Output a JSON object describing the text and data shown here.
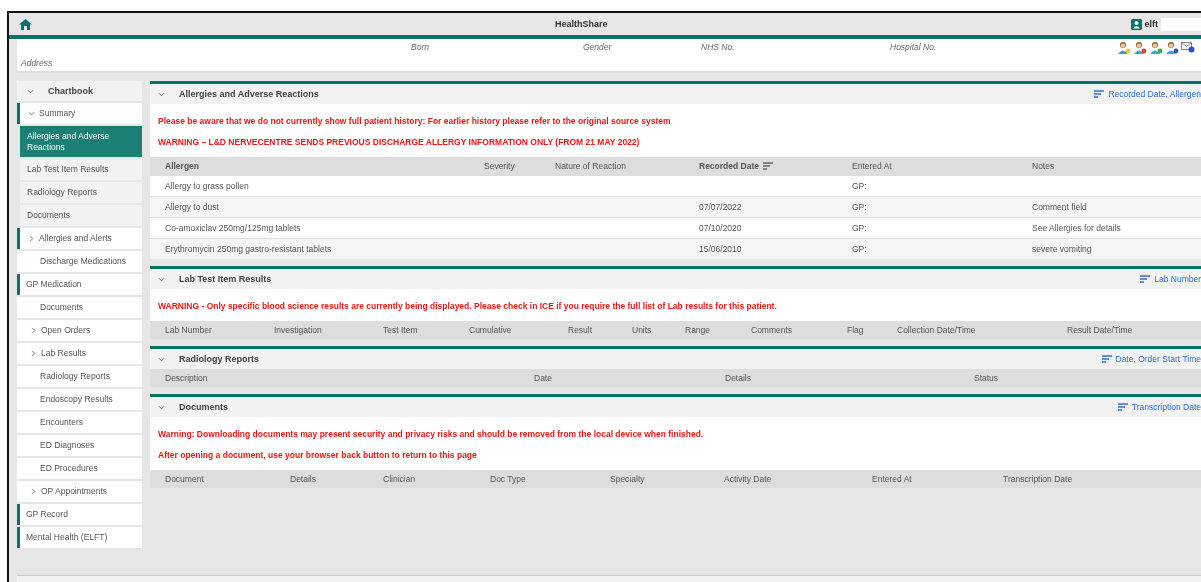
{
  "app_bar": {
    "title": "HealthShare",
    "user": "elft"
  },
  "patient_banner": {
    "fields": [
      "Born",
      "Gender",
      "NHS No.",
      "Hospital No."
    ],
    "address_label": "Address"
  },
  "sidebar": {
    "title": "Chartbook",
    "expanded": true,
    "items": [
      {
        "label": "Summary",
        "kind": "section",
        "expanded": true,
        "selected": false
      },
      {
        "label": "Allergies and Adverse Reactions",
        "kind": "child",
        "selected": true
      },
      {
        "label": "Lab Test Item Results",
        "kind": "child",
        "selected": false
      },
      {
        "label": "Radiology Reports",
        "kind": "child",
        "selected": false
      },
      {
        "label": "Documents",
        "kind": "child",
        "selected": false
      },
      {
        "label": "Allergies and Alerts",
        "kind": "section",
        "expanded": false,
        "selected": false
      },
      {
        "label": "Discharge Medications",
        "kind": "sub",
        "selected": false
      },
      {
        "label": "GP Medication",
        "kind": "section",
        "selected": false
      },
      {
        "label": "Documents",
        "kind": "sub",
        "selected": false
      },
      {
        "label": "Open Orders",
        "kind": "sub",
        "expanded": false,
        "selected": false
      },
      {
        "label": "Lab Results",
        "kind": "sub",
        "expanded": false,
        "selected": false
      },
      {
        "label": "Radiology Reports",
        "kind": "sub",
        "selected": false
      },
      {
        "label": "Endoscopy Results",
        "kind": "sub",
        "selected": false
      },
      {
        "label": "Encounters",
        "kind": "sub",
        "selected": false
      },
      {
        "label": "ED Diagnoses",
        "kind": "sub",
        "selected": false
      },
      {
        "label": "ED Procedures",
        "kind": "sub",
        "selected": false
      },
      {
        "label": "OP Appointments",
        "kind": "sub",
        "expanded": false,
        "selected": false
      },
      {
        "label": "GP Record",
        "kind": "section",
        "selected": false
      },
      {
        "label": "Mental Health (ELFT)",
        "kind": "section",
        "selected": false
      }
    ]
  },
  "sections": [
    {
      "kind": "allergies",
      "title": "Allergies and Adverse Reactions",
      "expanded": true,
      "sort": "Recorded Date, Allergen",
      "warnings": [
        "Please be aware that we do not currently show full patient history: For earlier history please refer to the original source system",
        "WARNING – L&D NERVECENTRE SENDS PREVIOUS DISCHARGE ALLERGY INFORMATION ONLY (FROM 21 MAY 2022)"
      ],
      "columns": [
        {
          "label": "Allergen",
          "bold": true,
          "sorted": false
        },
        {
          "label": "Severity",
          "bold": false,
          "sorted": false
        },
        {
          "label": "Nature of Reaction",
          "bold": false,
          "sorted": false
        },
        {
          "label": "Recorded Date",
          "bold": true,
          "sorted": true
        },
        {
          "label": "Entered At",
          "bold": false,
          "sorted": false
        },
        {
          "label": "Notes",
          "bold": false,
          "sorted": false
        }
      ],
      "rows": [
        [
          "Allergy to grass pollen",
          "",
          "",
          "",
          "GP:",
          ""
        ],
        [
          "Allergy to dust",
          "",
          "",
          "07/07/2022",
          "GP:",
          "Comment field"
        ],
        [
          "Co-amoxiclav 250mg/125mg tablets",
          "",
          "",
          "07/10/2020",
          "GP:",
          "See Allergies for details"
        ],
        [
          "Erythromycin 250mg gastro-resistant tablets",
          "",
          "",
          "15/06/2010",
          "GP:",
          "severe vomiting"
        ]
      ]
    },
    {
      "kind": "lab",
      "title": "Lab Test Item Results",
      "expanded": true,
      "sort": "Lab Number",
      "warnings": [
        "WARNING - Only specific blood science results are currently being displayed. Please check in ICE if you require the full list of Lab results for this patient."
      ],
      "columns": [
        {
          "label": "Lab Number",
          "bold": false,
          "sorted": false
        },
        {
          "label": "Investigation",
          "bold": false,
          "sorted": false
        },
        {
          "label": "Test Item",
          "bold": false,
          "sorted": false
        },
        {
          "label": "Cumulative",
          "bold": false,
          "sorted": false
        },
        {
          "label": "Result",
          "bold": false,
          "sorted": false
        },
        {
          "label": "Units",
          "bold": false,
          "sorted": false
        },
        {
          "label": "Range",
          "bold": false,
          "sorted": false
        },
        {
          "label": "Comments",
          "bold": false,
          "sorted": false
        },
        {
          "label": "Flag",
          "bold": false,
          "sorted": false
        },
        {
          "label": "Collection Date/Time",
          "bold": false,
          "sorted": false
        },
        {
          "label": "Result Date/Time",
          "bold": false,
          "sorted": false
        }
      ]
    },
    {
      "kind": "radiology",
      "title": "Radiology Reports",
      "expanded": true,
      "sort": "Date, Order Start Time",
      "columns": [
        {
          "label": "Description",
          "bold": false,
          "sorted": false
        },
        {
          "label": "Date",
          "bold": false,
          "sorted": false
        },
        {
          "label": "Details",
          "bold": false,
          "sorted": false
        },
        {
          "label": "Status",
          "bold": false,
          "sorted": false
        }
      ]
    },
    {
      "kind": "documents",
      "title": "Documents",
      "expanded": true,
      "sort": "Transcription Date",
      "warnings": [
        "Warning: Downloading documents may present security and privacy risks and should be removed from the local device when finished.",
        "After opening a document, use your browser back button to return to this page"
      ],
      "columns": [
        {
          "label": "Document",
          "bold": false,
          "sorted": false
        },
        {
          "label": "Details",
          "bold": false,
          "sorted": false
        },
        {
          "label": "Clinician",
          "bold": false,
          "sorted": false
        },
        {
          "label": "Doc Type",
          "bold": false,
          "sorted": false
        },
        {
          "label": "Specialty",
          "bold": false,
          "sorted": false
        },
        {
          "label": "Activity Date",
          "bold": false,
          "sorted": false
        },
        {
          "label": "Entered At",
          "bold": false,
          "sorted": false
        },
        {
          "label": "Transcription Date",
          "bold": false,
          "sorted": false
        }
      ]
    }
  ]
}
